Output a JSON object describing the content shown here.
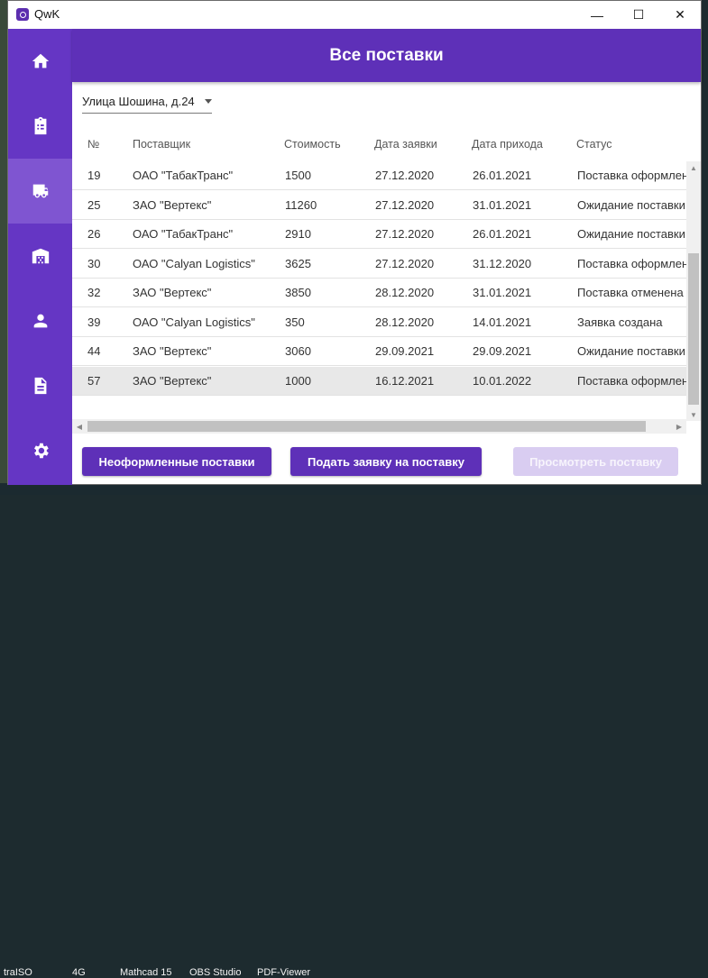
{
  "window": {
    "title": "QwK",
    "minimize_glyph": "—",
    "maximize_glyph": "☐",
    "close_glyph": "✕"
  },
  "taskbar": [
    "traISO",
    "4G",
    "Mathcad 15",
    "OBS Studio",
    "PDF-Viewer"
  ],
  "sidebar": {
    "items": [
      {
        "icon": "home-icon",
        "active": false
      },
      {
        "icon": "clipboard-icon",
        "active": false
      },
      {
        "icon": "truck-icon",
        "active": true
      },
      {
        "icon": "warehouse-icon",
        "active": false
      },
      {
        "icon": "person-icon",
        "active": false
      },
      {
        "icon": "document-icon",
        "active": false
      },
      {
        "icon": "gear-icon",
        "active": false
      }
    ]
  },
  "header": {
    "title": "Все поставки"
  },
  "branch": {
    "selected": "Улица Шошина, д.24"
  },
  "table": {
    "columns": [
      "№",
      "Поставщик",
      "Стоимость",
      "Дата заявки",
      "Дата прихода",
      "Статус"
    ],
    "rows": [
      [
        "19",
        "ОАО \"ТабакТранс\"",
        "1500",
        "27.12.2020",
        "26.01.2021",
        "Поставка оформлена"
      ],
      [
        "25",
        "ЗАО \"Вертекс\"",
        "11260",
        "27.12.2020",
        "31.01.2021",
        "Ожидание поставки"
      ],
      [
        "26",
        "ОАО \"ТабакТранс\"",
        "2910",
        "27.12.2020",
        "26.01.2021",
        "Ожидание поставки"
      ],
      [
        "30",
        "ОАО \"Calyan Logistics\"",
        "3625",
        "27.12.2020",
        "31.12.2020",
        "Поставка оформлена"
      ],
      [
        "32",
        "ЗАО \"Вертекс\"",
        "3850",
        "28.12.2020",
        "31.01.2021",
        "Поставка отменена"
      ],
      [
        "39",
        "ОАО \"Calyan Logistics\"",
        "350",
        "28.12.2020",
        "14.01.2021",
        "Заявка создана"
      ],
      [
        "44",
        "ЗАО \"Вертекс\"",
        "3060",
        "29.09.2021",
        "29.09.2021",
        "Ожидание поставки"
      ],
      [
        "57",
        "ЗАО \"Вертекс\"",
        "1000",
        "16.12.2021",
        "10.01.2022",
        "Поставка оформлена"
      ]
    ],
    "selected_row": 7
  },
  "buttons": {
    "unregistered": "Неоформленные поставки",
    "submit_request": "Подать заявку на поставку",
    "view": "Просмотреть поставку"
  }
}
